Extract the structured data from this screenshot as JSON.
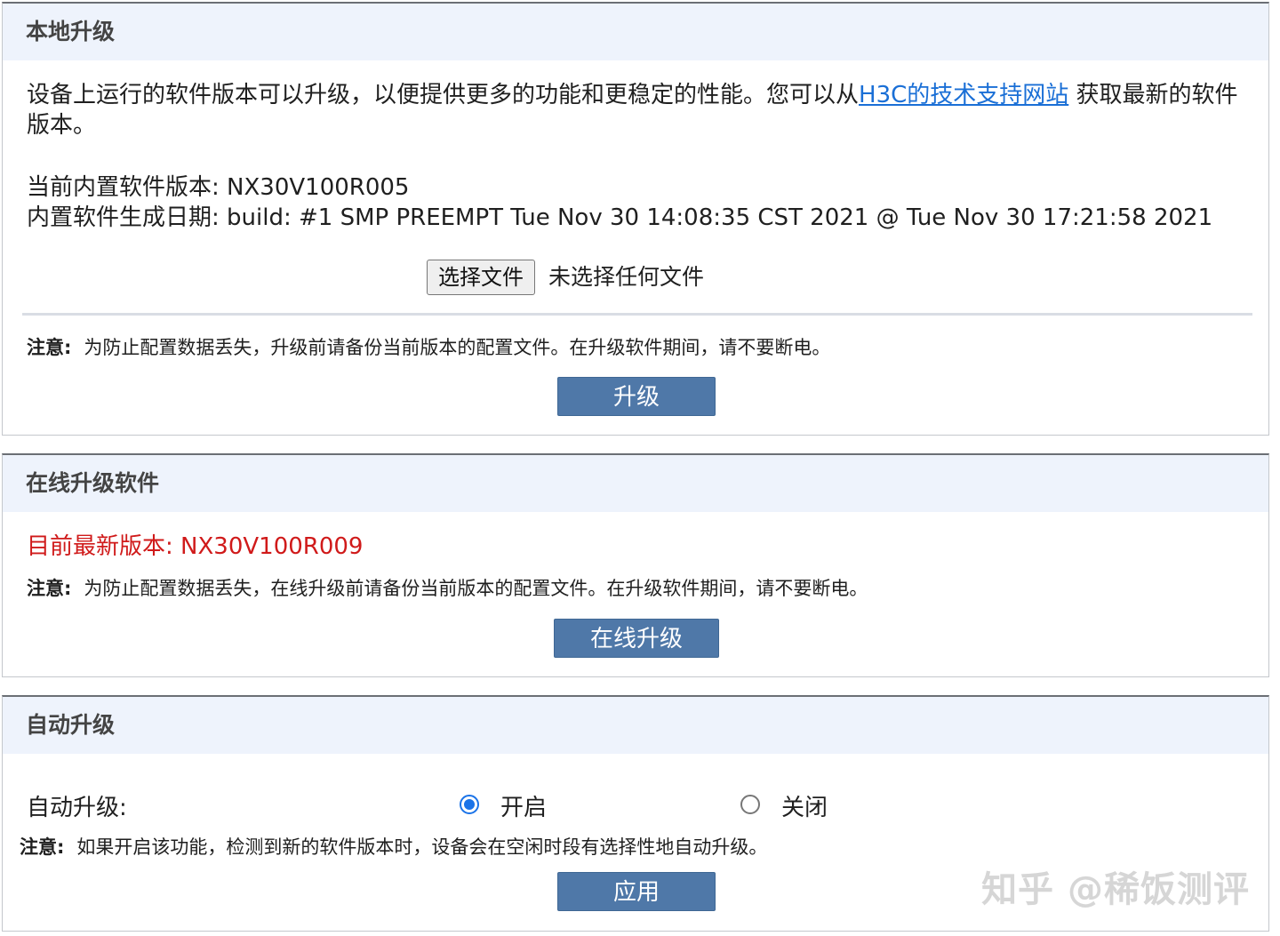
{
  "local_upgrade": {
    "title": "本地升级",
    "desc_before_link": "设备上运行的软件版本可以升级，以便提供更多的功能和更稳定的性能。您可以从",
    "link_text": "H3C的技术支持网站",
    "desc_after_link": " 获取最新的软件版本。",
    "current_version": "当前内置软件版本: NX30V100R005",
    "build_date": "内置软件生成日期:  build: #1 SMP PREEMPT Tue Nov 30 14:08:35 CST 2021 @ Tue Nov 30 17:21:58 2021",
    "choose_file_label": "选择文件",
    "file_status": "未选择任何文件",
    "note_label": "注意:",
    "note_text": "为防止配置数据丢失，升级前请备份当前版本的配置文件。在升级软件期间，请不要断电。",
    "upgrade_button": "升级"
  },
  "online_upgrade": {
    "title": "在线升级软件",
    "latest_version": "目前最新版本: NX30V100R009",
    "note_label": "注意:",
    "note_text": "为防止配置数据丢失，在线升级前请备份当前版本的配置文件。在升级软件期间，请不要断电。",
    "button": "在线升级"
  },
  "auto_upgrade": {
    "title": "自动升级",
    "field_label": "自动升级:",
    "option_on": "开启",
    "option_off": "关闭",
    "selected": "开启",
    "note_label": "注意:",
    "note_text": "如果开启该功能，检测到新的软件版本时，设备会在空闲时段有选择性地自动升级。",
    "button": "应用"
  },
  "watermark": "知乎 @稀饭测评",
  "colors": {
    "header_bg": "#eef3fc",
    "button_bg": "#4f78a8",
    "link": "#1a6fd6",
    "latest_version": "#d01a1a",
    "radio_selected": "#1a73e8"
  }
}
